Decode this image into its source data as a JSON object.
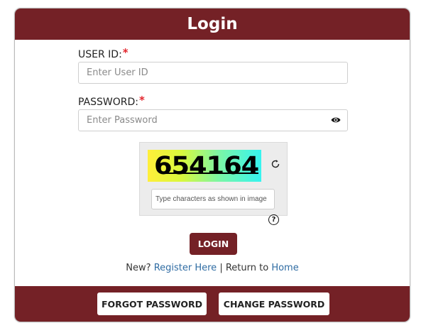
{
  "header": {
    "title": "Login"
  },
  "form": {
    "user_id": {
      "label": "USER ID:",
      "required_mark": "*",
      "value": "",
      "placeholder": "Enter User ID"
    },
    "password": {
      "label": "PASSWORD:",
      "required_mark": "*",
      "value": "",
      "placeholder": "Enter Password",
      "toggle_icon": "eye-icon"
    }
  },
  "captcha": {
    "code": "654164",
    "refresh_icon": "refresh-icon",
    "input_value": "",
    "input_placeholder": "Type characters as shown in image",
    "help_symbol": "?"
  },
  "login_button": {
    "label": "LOGIN"
  },
  "links": {
    "new_prefix": "New?",
    "register_label": "Register Here",
    "separator": "|",
    "return_prefix": "Return to",
    "home_label": "Home"
  },
  "footer": {
    "forgot_label": "FORGOT PASSWORD",
    "change_label": "CHANGE PASSWORD"
  },
  "colors": {
    "brand": "#742126",
    "required": "#e3262d",
    "link": "#2f6ca3"
  }
}
